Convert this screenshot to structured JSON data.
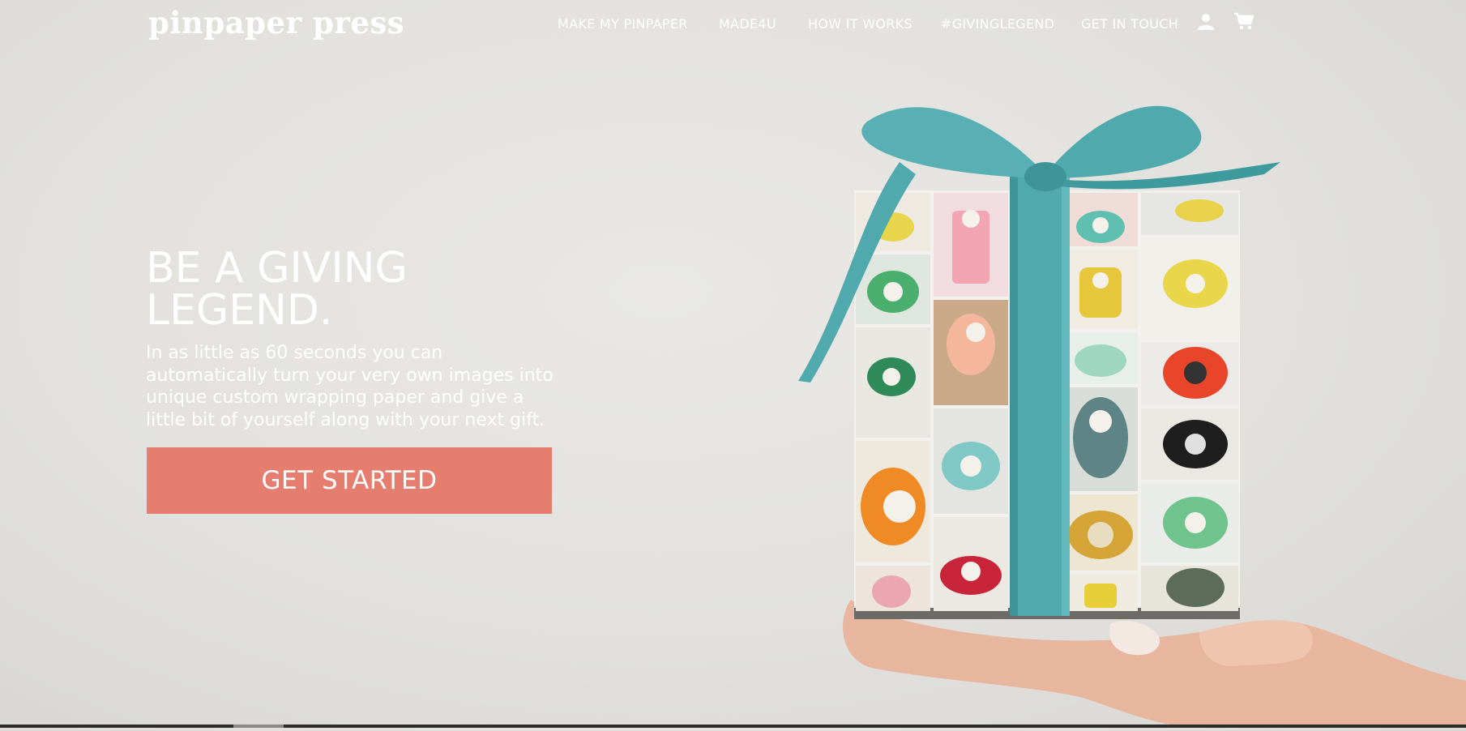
{
  "header": {
    "logo_text": "pinpaper press",
    "nav_items": [
      {
        "label": "MAKE MY PINPAPER"
      },
      {
        "label": "MADE4U"
      },
      {
        "label": "HOW IT WORKS"
      },
      {
        "label": "#GIVINGLEGEND"
      },
      {
        "label": "GET IN TOUCH"
      }
    ],
    "account_icon": "user-icon",
    "cart_icon": "cart-icon"
  },
  "hero": {
    "title_line1": "BE A GIVING",
    "title_line2": "LEGEND.",
    "body": "In as little as 60 seconds you can automatically turn your very own images into unique custom wrapping paper and give a little bit of yourself along with your next gift.",
    "cta_label": "GET STARTED",
    "image_icon": "gift-box-image"
  },
  "colors": {
    "accent": "#e67e70",
    "ribbon": "#4fa9ad",
    "background": "#e4e3df",
    "text": "#ffffff"
  }
}
